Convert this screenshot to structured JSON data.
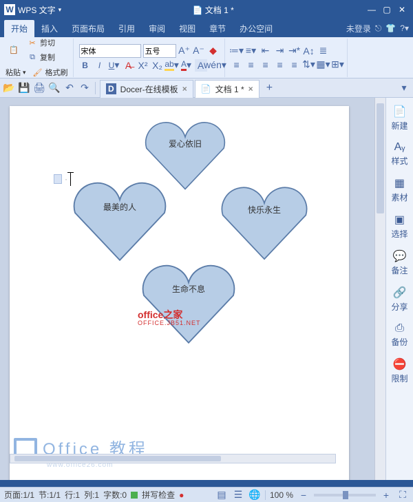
{
  "titlebar": {
    "app": "WPS 文字",
    "docname": "文档 1 *"
  },
  "menu": {
    "tabs": [
      "开始",
      "插入",
      "页面布局",
      "引用",
      "审阅",
      "视图",
      "章节",
      "办公空间"
    ],
    "login": "未登录"
  },
  "ribbon": {
    "cut": "剪切",
    "copy": "复制",
    "paste": "粘贴",
    "format_painter": "格式刷",
    "font_name": "宋体",
    "font_size": "五号"
  },
  "doctabs": {
    "template": "Docer-在线模板",
    "doc": "文档 1 *"
  },
  "hearts": {
    "h1": "爱心依旧",
    "h2": "最美的人",
    "h3": "快乐永生",
    "h4": "生命不息"
  },
  "watermark": {
    "line1": "office之家",
    "line2": "OFFICE.JB51.NET"
  },
  "bigwm": {
    "title": "Office 教程",
    "sub": "www.office26.com"
  },
  "sidepanel": {
    "s1": "新建",
    "s2": "样式",
    "s3": "素材",
    "s4": "选择",
    "s5": "备注",
    "s6": "分享",
    "s7": "备份",
    "s8": "限制"
  },
  "status": {
    "page": "页面:1/1",
    "sec": "节:1/1",
    "line": "行:1",
    "col": "列:1",
    "chars": "字数:0",
    "spell": "拼写检查",
    "zoom": "100 %"
  }
}
